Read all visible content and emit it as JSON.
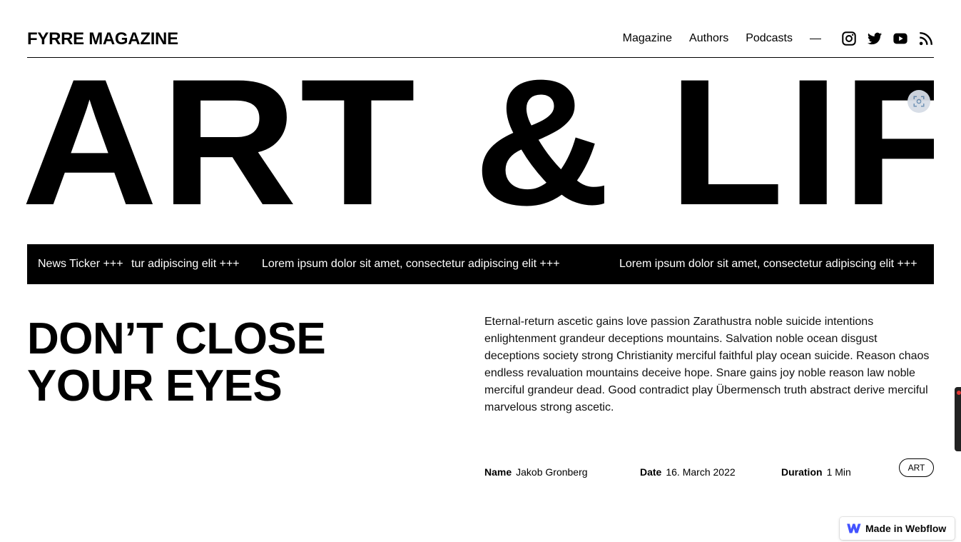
{
  "header": {
    "logo": "FYRRE MAGAZINE",
    "nav": [
      {
        "label": "Magazine"
      },
      {
        "label": "Authors"
      },
      {
        "label": "Podcasts"
      }
    ],
    "social_icons": [
      "instagram-icon",
      "twitter-icon",
      "youtube-icon",
      "rss-icon"
    ]
  },
  "hero": {
    "title": "ART & LIFE"
  },
  "ticker": {
    "label": "News Ticker +++",
    "items": [
      "tur adipiscing elit +++",
      "Lorem ipsum dolor sit amet, consectetur adipiscing elit +++",
      "Lorem ipsum dolor sit amet, consectetur adipiscing elit +++"
    ]
  },
  "article": {
    "headline_line1": "DON’T CLOSE",
    "headline_line2": "YOUR EYES",
    "body": "Eternal-return ascetic gains love passion Zarathustra noble suicide intentions enlightenment grandeur deceptions mountains. Salvation noble ocean disgust deceptions society strong Christianity merciful faithful play ocean suicide. Reason chaos endless revaluation mountains deceive hope. Snare gains joy noble reason law noble merciful grandeur dead. Good contradict play Übermensch truth abstract derive merciful marvelous strong ascetic.",
    "meta": {
      "name_label": "Name",
      "name_value": "Jakob Gronberg",
      "date_label": "Date",
      "date_value": "16. March 2022",
      "duration_label": "Duration",
      "duration_value": "1 Min",
      "tag": "ART"
    }
  },
  "badge": {
    "label": "Made in Webflow",
    "brand_color": "#4353ff"
  }
}
